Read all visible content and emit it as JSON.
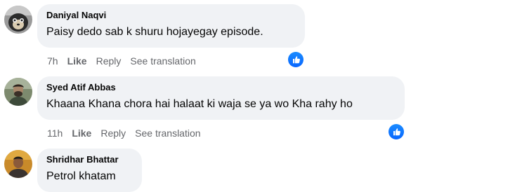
{
  "comments": [
    {
      "author": "Daniyal Naqvi",
      "text": "Paisy dedo sab k shuru hojayegay episode.",
      "time": "7h",
      "like_label": "Like",
      "reply_label": "Reply",
      "translate_label": "See translation",
      "reaction_icon": "like-reaction-icon"
    },
    {
      "author": "Syed Atif Abbas",
      "text": "Khaana Khana chora hai halaat ki waja se ya wo Kha rahy ho",
      "time": "11h",
      "like_label": "Like",
      "reply_label": "Reply",
      "translate_label": "See translation",
      "reaction_icon": "like-reaction-icon"
    },
    {
      "author": "Shridhar Bhattar",
      "text": "Petrol khatam"
    }
  ],
  "colors": {
    "bubble_bg": "#f0f2f5",
    "meta_text": "#65676b",
    "like_blue": "#0866ff"
  }
}
